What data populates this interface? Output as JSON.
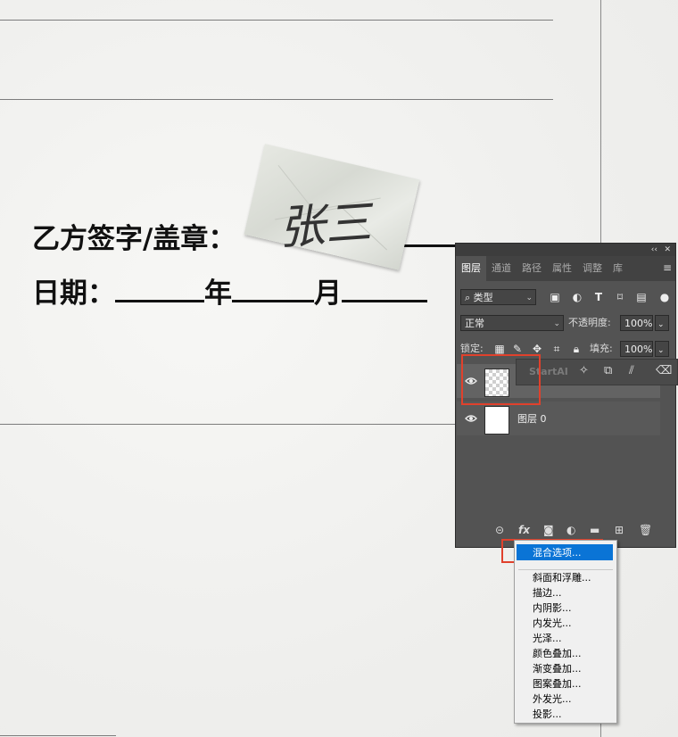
{
  "document": {
    "party_b_label": "乙方签字/盖章：",
    "date_label": "日期：",
    "year": "年",
    "month": "月",
    "colon_fragment": "：",
    "signature_text": "张三"
  },
  "layers_panel": {
    "collapse_glyph": "‹‹",
    "close_glyph": "✕",
    "tabs": [
      {
        "label": "图层",
        "active": true
      },
      {
        "label": "通道",
        "active": false
      },
      {
        "label": "路径",
        "active": false
      },
      {
        "label": "属性",
        "active": false
      },
      {
        "label": "调整",
        "active": false
      },
      {
        "label": "库",
        "active": false
      }
    ],
    "menu_glyph": "≡",
    "filter_kind": "类型",
    "blend_mode": "正常",
    "opacity_label": "不透明度:",
    "opacity_value": "100%",
    "lock_label": "锁定:",
    "fill_label": "填充:",
    "fill_value": "100%",
    "starti_label": "StartAI",
    "layers": [
      {
        "name": "",
        "thumb": "transparent",
        "visible": true
      },
      {
        "name": "图层 0",
        "thumb": "document",
        "visible": true
      }
    ],
    "fx_label": "fx"
  },
  "fx_menu": {
    "highlighted": "混合选项...",
    "items": [
      "斜面和浮雕...",
      "描边...",
      "内阴影...",
      "内发光...",
      "光泽...",
      "颜色叠加...",
      "渐变叠加...",
      "图案叠加...",
      "外发光...",
      "投影..."
    ]
  },
  "colors": {
    "panel_bg": "#535353",
    "highlight": "#0a74d6",
    "annotation_red": "#e0412c"
  }
}
